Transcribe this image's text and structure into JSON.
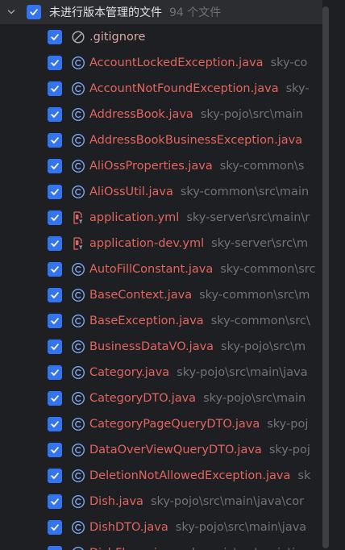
{
  "group": {
    "title": "未进行版本管理的文件",
    "count": "94 个文件"
  },
  "files": [
    {
      "name": ".gitignore",
      "path": "",
      "icon": "ignored-file-icon"
    },
    {
      "name": "AccountLockedException.java",
      "path": "sky-co",
      "icon": "java-class-icon"
    },
    {
      "name": "AccountNotFoundException.java",
      "path": "sky-",
      "icon": "java-class-icon"
    },
    {
      "name": "AddressBook.java",
      "path": "sky-pojo\\src\\main",
      "icon": "java-class-icon"
    },
    {
      "name": "AddressBookBusinessException.java",
      "path": "",
      "icon": "java-class-icon"
    },
    {
      "name": "AliOssProperties.java",
      "path": "sky-common\\s",
      "icon": "java-class-icon"
    },
    {
      "name": "AliOssUtil.java",
      "path": "sky-common\\src\\main",
      "icon": "java-class-icon"
    },
    {
      "name": "application.yml",
      "path": "sky-server\\src\\main\\r",
      "icon": "yaml-file-icon"
    },
    {
      "name": "application-dev.yml",
      "path": "sky-server\\src\\m",
      "icon": "yaml-file-icon"
    },
    {
      "name": "AutoFillConstant.java",
      "path": "sky-common\\src",
      "icon": "java-class-icon"
    },
    {
      "name": "BaseContext.java",
      "path": "sky-common\\src\\m",
      "icon": "java-class-icon"
    },
    {
      "name": "BaseException.java",
      "path": "sky-common\\src\\",
      "icon": "java-class-icon"
    },
    {
      "name": "BusinessDataVO.java",
      "path": "sky-pojo\\src\\m",
      "icon": "java-class-icon"
    },
    {
      "name": "Category.java",
      "path": "sky-pojo\\src\\main\\java",
      "icon": "java-class-icon"
    },
    {
      "name": "CategoryDTO.java",
      "path": "sky-pojo\\src\\main",
      "icon": "java-class-icon"
    },
    {
      "name": "CategoryPageQueryDTO.java",
      "path": "sky-poj",
      "icon": "java-class-icon"
    },
    {
      "name": "DataOverViewQueryDTO.java",
      "path": "sky-poj",
      "icon": "java-class-icon"
    },
    {
      "name": "DeletionNotAllowedException.java",
      "path": "sk",
      "icon": "java-class-icon"
    },
    {
      "name": "Dish.java",
      "path": "sky-pojo\\src\\main\\java\\cor",
      "icon": "java-class-icon"
    },
    {
      "name": "DishDTO.java",
      "path": "sky-pojo\\src\\main\\java",
      "icon": "java-class-icon"
    },
    {
      "name": "DishFlavor.java",
      "path": "sky-pojo\\src\\main\\ja",
      "icon": "java-class-icon"
    }
  ]
}
